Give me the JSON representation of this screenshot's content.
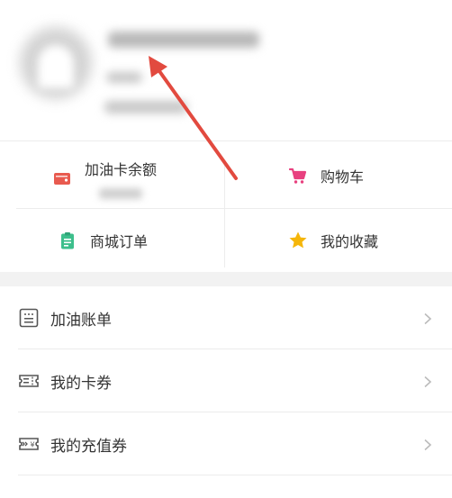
{
  "quick_actions": {
    "fuel_card_balance": "加油卡余额",
    "shopping_cart": "购物车",
    "mall_orders": "商城订单",
    "favorites": "我的收藏"
  },
  "menu": [
    {
      "label": "加油账单",
      "icon": "bill-icon"
    },
    {
      "label": "我的卡券",
      "icon": "ticket-icon"
    },
    {
      "label": "我的充值券",
      "icon": "voucher-icon"
    }
  ],
  "colors": {
    "card_red": "#e85a4f",
    "cart_pink": "#e8407f",
    "orders_green": "#3dbf8c",
    "star_yellow": "#f5b60a",
    "arrow_red": "#e24a3f"
  }
}
